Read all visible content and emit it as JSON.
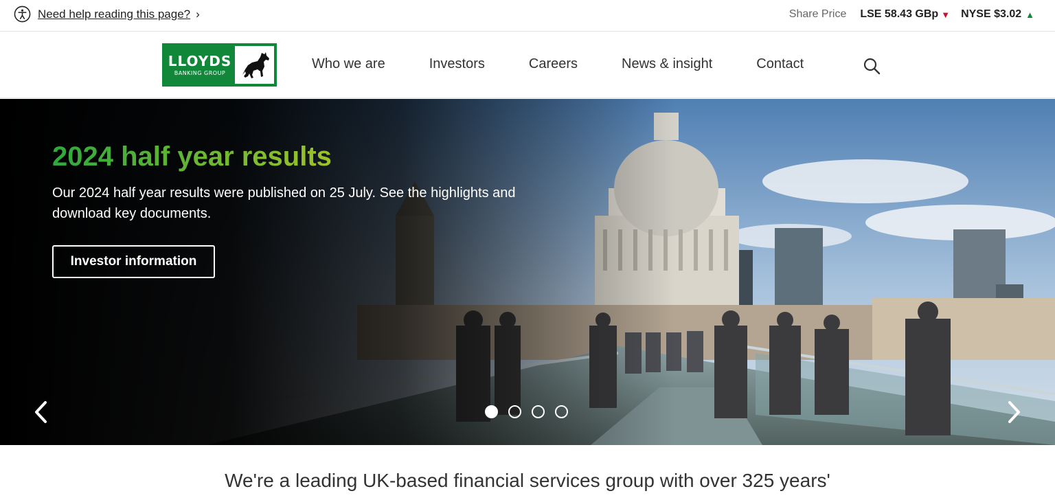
{
  "utility": {
    "help_link": "Need help reading this page?",
    "share_price_label": "Share Price",
    "lse": "LSE 58.43 GBp",
    "nyse": "NYSE $3.02"
  },
  "header": {
    "logo_main": "LLOYDS",
    "logo_sub": "BANKING GROUP",
    "nav": [
      "Who we are",
      "Investors",
      "Careers",
      "News & insight",
      "Contact"
    ]
  },
  "hero": {
    "title": "2024 half year results",
    "text": "Our 2024 half year results were published on 25 July. See the highlights and download key documents.",
    "button": "Investor information",
    "slides_total": 4,
    "active_slide": 1
  },
  "intro": {
    "text": "We're a leading UK-based financial services group with over 325 years'"
  },
  "colors": {
    "brand_green": "#11873a",
    "price_down": "#c8102e",
    "price_up": "#11873a"
  },
  "icons": [
    "accessibility-icon",
    "chevron-right-icon",
    "triangle-down-icon",
    "triangle-up-icon",
    "horse-logo-icon",
    "search-icon",
    "chevron-left-icon"
  ]
}
